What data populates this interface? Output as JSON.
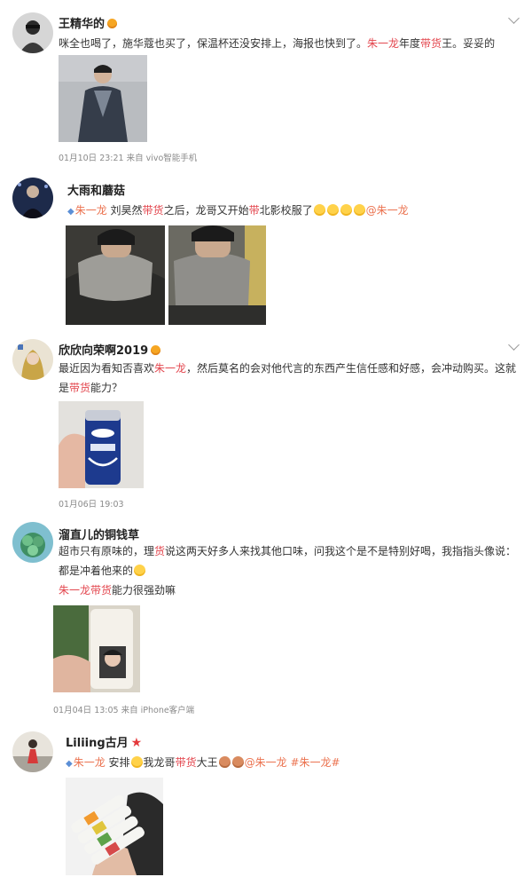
{
  "posts": [
    {
      "username": "王精华的",
      "text_a": "咪全也喝了，施华蔻也买了，保温杯还没安排上，海报也快到了。",
      "kw_a": "朱一龙",
      "text_b": "年度",
      "kw_b": "带货",
      "text_c": "王。妥妥的",
      "meta": "01月10日 23:21  来自 vivo智能手机"
    },
    {
      "username": "大雨和蘑菇",
      "tag": "朱一龙",
      "text_a": " 刘昊然",
      "kw_a": "带货",
      "text_b": "之后，龙哥又开始",
      "kw_b": "带",
      "text_c": "北影校服了",
      "mention": "@朱一龙"
    },
    {
      "username": "欣欣向荣啊2019",
      "text_a": "最近因为看知否喜欢",
      "kw_a": "朱一龙",
      "text_b": "，然后莫名的会对他代言的东西产生信任感和好感，会冲动购买。这就是",
      "kw_b": "带货",
      "text_c": "能力？",
      "meta": "01月06日 19:03"
    },
    {
      "username": "溜直儿的铜钱草",
      "text_a": "超市只有原味的，理",
      "kw_a": "货",
      "text_b": "说这两天好多人来找其他口味，问我这个是不是特别好喝，我指指头像说：都是冲着他来的",
      "kw_b": "朱一龙带货",
      "text_c": "能力很强劲嘛",
      "meta": "01月04日 13:05  来自 iPhone客户端"
    },
    {
      "username": "Liliing古月",
      "tag": "朱一龙",
      "text_a": " 安排",
      "text_b": "我龙哥",
      "kw_b": "带货",
      "text_c": "大王",
      "mention": "@朱一龙",
      "hashtag": "#朱一龙#"
    }
  ],
  "icons": {
    "badge": "vip-badge-icon",
    "star": "star-badge-icon",
    "chevron": "chevron-down-icon",
    "diamond": "super-topic-icon",
    "emoji": "emoji-icon"
  },
  "colors": {
    "keyword": "#e3474f",
    "link": "#eb7350",
    "meta": "#8a8a8a"
  }
}
